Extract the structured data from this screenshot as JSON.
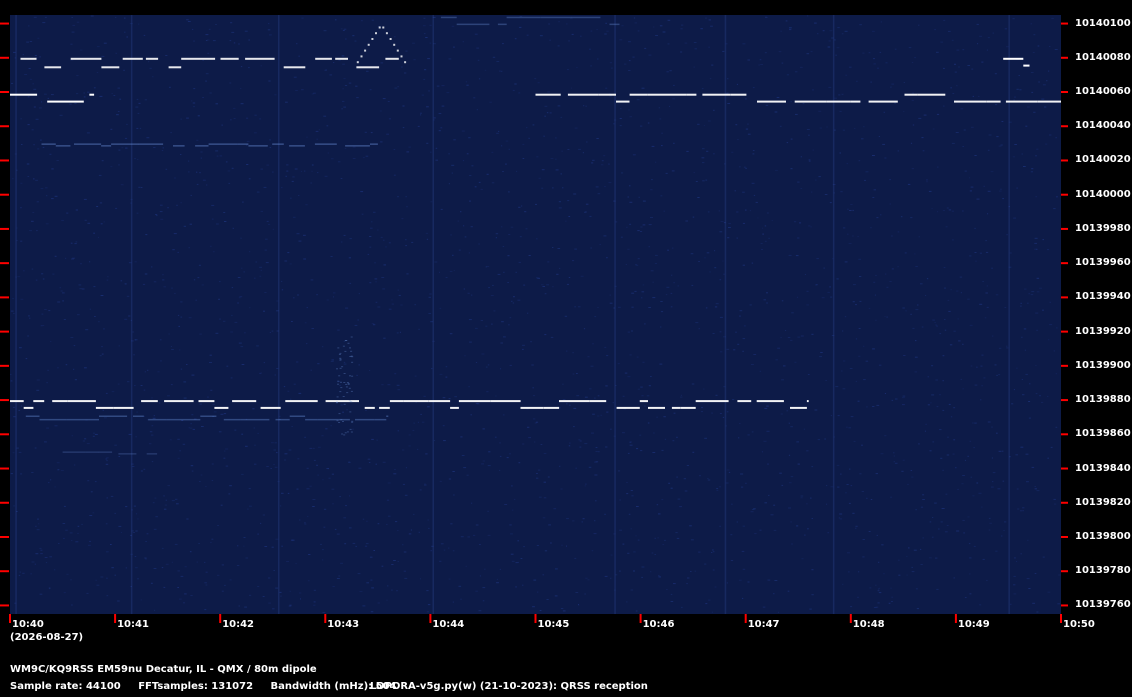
{
  "chart_data": {
    "type": "heatmap",
    "subtype": "QRSS waterfall spectrogram",
    "x_axis": {
      "ticks": [
        "10:40",
        "10:41",
        "10:42",
        "10:43",
        "10:44",
        "10:45",
        "10:46",
        "10:47",
        "10:48",
        "10:49",
        "10:50"
      ],
      "range_minutes": [
        0,
        10
      ],
      "start_time": "10:40",
      "date": "(2026-08-27)"
    },
    "y_axis": {
      "unit": "Hz",
      "range": [
        10139755,
        10140105
      ],
      "ticks": [
        "10140100",
        "10140080",
        "10140060",
        "10140040",
        "10140020",
        "10140000",
        "10139980",
        "10139960",
        "10139940",
        "10139920",
        "10139900",
        "10139880",
        "10139860",
        "10139840",
        "10139820",
        "10139800",
        "10139780",
        "10139760"
      ],
      "tick_side": "right",
      "tick_color": "#ff0000"
    },
    "colors": {
      "background": "#0d1b48",
      "noise": "#1c3278",
      "trace": "#ffffff",
      "faint_trace": "#6a8fd8",
      "tick": "#ff0000"
    },
    "traces": [
      {
        "freq_high": 10140080,
        "freq_low": 10140075,
        "start_min": 0.1,
        "end_min": 3.7,
        "intensity": 0.9
      },
      {
        "freq_high": 10140100,
        "freq_low": 10140078,
        "start_min": 3.3,
        "end_min": 3.75,
        "intensity": 0.8,
        "shape": "triangle"
      },
      {
        "freq_high": 10140104,
        "freq_low": 10140100,
        "start_min": 4.1,
        "end_min": 5.8,
        "intensity": 0.35
      },
      {
        "freq_high": 10140059,
        "freq_low": 10140055,
        "start_min": 0.0,
        "end_min": 0.8,
        "intensity": 1.0
      },
      {
        "freq_high": 10140059,
        "freq_low": 10140055,
        "start_min": 5.0,
        "end_min": 10.0,
        "intensity": 0.95
      },
      {
        "freq_high": 10140080,
        "freq_low": 10140076,
        "start_min": 9.45,
        "end_min": 9.7,
        "intensity": 1.0
      },
      {
        "freq_high": 10140030,
        "freq_low": 10140029,
        "start_min": 0.3,
        "end_min": 3.5,
        "intensity": 0.45
      },
      {
        "freq_high": 10139880,
        "freq_low": 10139876,
        "start_min": 0.0,
        "end_min": 7.6,
        "intensity": 0.95
      },
      {
        "freq_high": 10139871,
        "freq_low": 10139869,
        "start_min": 0.15,
        "end_min": 3.6,
        "intensity": 0.4
      },
      {
        "freq_high": 10139920,
        "freq_low": 10139900,
        "start_min": 3.1,
        "end_min": 3.25,
        "intensity": 0.35,
        "shape": "burst"
      },
      {
        "freq_high": 10139850,
        "freq_low": 10139849,
        "start_min": 0.5,
        "end_min": 1.4,
        "intensity": 0.25
      }
    ]
  },
  "footer": {
    "station": "WM9C/KQ9RSS EM59nu Decatur, IL - QMX / 80m dipole",
    "sample_rate": "Sample rate: 44100",
    "fft_samples": "FFTsamples: 131072",
    "bandwidth": "Bandwidth (mHz): 504",
    "software": "LOPORA-v5g.py(w) (21-10-2023): QRSS reception"
  }
}
